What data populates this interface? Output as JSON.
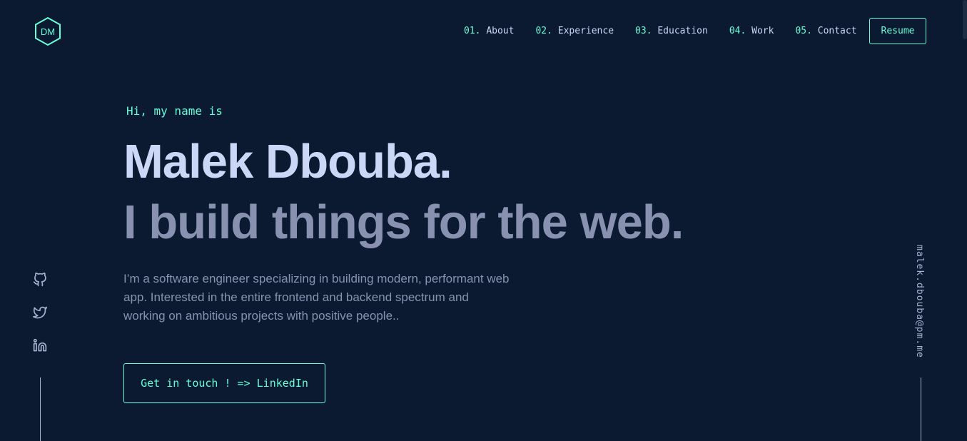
{
  "logo": {
    "text": "DM"
  },
  "nav": {
    "items": [
      {
        "num": "01.",
        "label": "About"
      },
      {
        "num": "02.",
        "label": "Experience"
      },
      {
        "num": "03.",
        "label": "Education"
      },
      {
        "num": "04.",
        "label": "Work"
      },
      {
        "num": "05.",
        "label": "Contact"
      }
    ],
    "resume_label": "Resume"
  },
  "hero": {
    "intro": "Hi, my name is",
    "name": "Malek Dbouba.",
    "tagline": "I build things for the web.",
    "bio": "I’m a software engineer specializing in building modern, performant web app. Interested in the entire frontend and backend spectrum and working on ambitious projects with positive people..",
    "cta_label": "Get in touch ! => LinkedIn"
  },
  "social": {
    "icons": [
      "github-icon",
      "twitter-icon",
      "linkedin-icon"
    ]
  },
  "email": "malek.dbouba@pm.me",
  "colors": {
    "background": "#0b1a30",
    "accent": "#64ffda",
    "heading": "#ccd6f6",
    "text": "#8892b0"
  }
}
